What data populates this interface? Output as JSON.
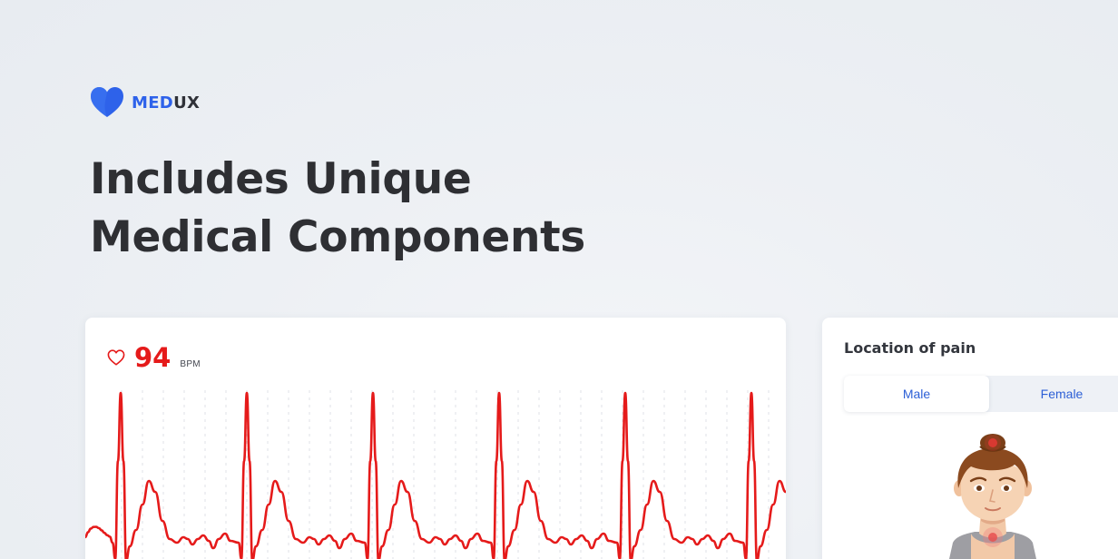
{
  "brand": {
    "part1": "MED",
    "part2": "UX",
    "accent_color": "#2e62ea",
    "icon": "heart-logo-icon"
  },
  "headline": {
    "line1": "Includes Unique",
    "line2": "Medical Components"
  },
  "heart_rate": {
    "value": "94",
    "unit": "BPM",
    "icon": "heart-outline-icon",
    "color": "#e51a1a"
  },
  "pain_location": {
    "title": "Location of pain",
    "tabs": [
      "Male",
      "Female"
    ],
    "selected_tab": "Male",
    "marker_color": "#e53935"
  }
}
